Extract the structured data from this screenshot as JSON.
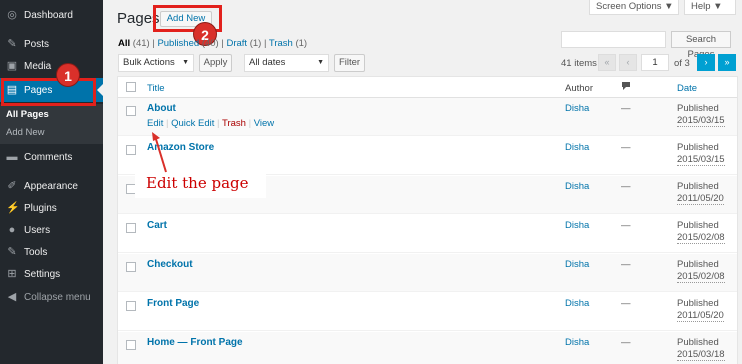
{
  "sidebar": {
    "items": [
      {
        "label": "Dashboard",
        "icon": "dashboard-icon",
        "glyph": "◎"
      },
      {
        "label": "Posts",
        "icon": "pushpin-icon",
        "glyph": "✎"
      },
      {
        "label": "Media",
        "icon": "media-icon",
        "glyph": "▣"
      },
      {
        "label": "Pages",
        "icon": "pages-icon",
        "glyph": "▤"
      },
      {
        "label": "Comments",
        "icon": "comments-icon",
        "glyph": "▬"
      },
      {
        "label": "Appearance",
        "icon": "appearance-icon",
        "glyph": "✐"
      },
      {
        "label": "Plugins",
        "icon": "plugins-icon",
        "glyph": "⚡"
      },
      {
        "label": "Users",
        "icon": "users-icon",
        "glyph": "●"
      },
      {
        "label": "Tools",
        "icon": "tools-icon",
        "glyph": "✎"
      },
      {
        "label": "Settings",
        "icon": "settings-icon",
        "glyph": "⊞"
      },
      {
        "label": "Collapse menu",
        "icon": "collapse-icon",
        "glyph": "◀"
      }
    ],
    "submenu": [
      "All Pages",
      "Add New"
    ]
  },
  "annotations": {
    "num1": "1",
    "num2": "2",
    "callout": "Edit the page"
  },
  "header": {
    "title": "Pages",
    "add_new": "Add New",
    "screen_options": "Screen Options ▼",
    "help": "Help ▼"
  },
  "filters": {
    "all": "All",
    "all_count": "(41)",
    "published": "Published",
    "published_count": "(40)",
    "draft": "Draft",
    "draft_count": "(1)",
    "trash": "Trash",
    "trash_count": "(1)"
  },
  "search": {
    "button": "Search Pages"
  },
  "bulk": {
    "action": "Bulk Actions",
    "apply": "Apply",
    "dates": "All dates",
    "filter": "Filter"
  },
  "pagination": {
    "items": "41 items",
    "first": "«",
    "prev": "‹",
    "current": "1",
    "of": "of 3",
    "next": "›",
    "last": "»"
  },
  "table": {
    "headers": {
      "title": "Title",
      "author": "Author",
      "comments_icon": "comment-bubble-icon",
      "date": "Date"
    },
    "rows": [
      {
        "title": "About",
        "author": "Disha",
        "comments": "—",
        "status": "Published",
        "date": "2015/03/15"
      },
      {
        "title": "Amazon Store",
        "author": "Disha",
        "comments": "—",
        "status": "Published",
        "date": "2015/03/15"
      },
      {
        "title": "",
        "author": "Disha",
        "comments": "—",
        "status": "Published",
        "date": "2011/05/20"
      },
      {
        "title": "Cart",
        "author": "Disha",
        "comments": "—",
        "status": "Published",
        "date": "2015/02/08"
      },
      {
        "title": "Checkout",
        "author": "Disha",
        "comments": "—",
        "status": "Published",
        "date": "2015/02/08"
      },
      {
        "title": "Front Page",
        "author": "Disha",
        "comments": "—",
        "status": "Published",
        "date": "2011/05/20"
      },
      {
        "title": "Home — Front Page",
        "author": "Disha",
        "comments": "—",
        "status": "Published",
        "date": "2015/03/18"
      }
    ],
    "row_actions": {
      "edit": "Edit",
      "quick_edit": "Quick Edit",
      "trash": "Trash",
      "view": "View"
    }
  },
  "colors": {
    "accent": "#0073aa",
    "annotation": "#e2211c",
    "sidebar_bg": "#23282d"
  }
}
